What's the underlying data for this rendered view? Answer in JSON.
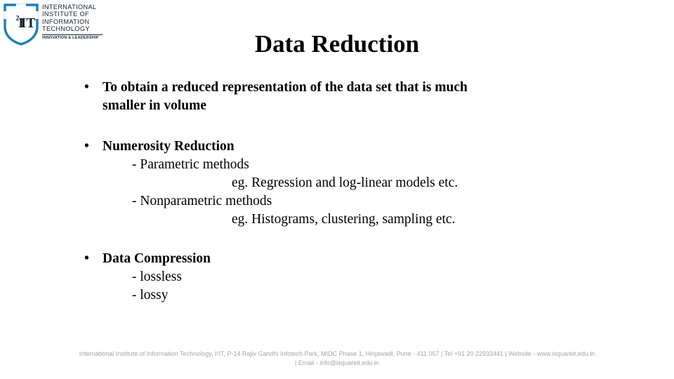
{
  "slide": {
    "title": "Data Reduction",
    "background_color": "#ffffff",
    "text_color": "#000000"
  },
  "logo": {
    "shield_icon": "i2it-shield-icon",
    "shield_color": "#1b7fb8",
    "monogram": "I2IT",
    "name_lines": [
      "INTERNATIONAL",
      "INSTITUTE OF",
      "INFORMATION",
      "TECHNOLOGY"
    ],
    "tagline": "INNOVATION & LEADERSHIP"
  },
  "content": {
    "bullet1": {
      "marker": "•",
      "line1": "To obtain a reduced representation of the data set that is much",
      "line2": "smaller in volume"
    },
    "bullet2": {
      "marker": "•",
      "heading": "Numerosity Reduction",
      "sub1": "- Parametric methods",
      "eg1": "eg. Regression and log-linear models etc.",
      "sub2": "- Nonparametric methods",
      "eg2": "eg. Histograms, clustering, sampling etc."
    },
    "bullet3": {
      "marker": "•",
      "heading": "Data Compression",
      "sub1": "- lossless",
      "sub2": "- lossy"
    }
  },
  "footer": {
    "line1": "International Institute of Information Technology, I²IT, P-14 Rajiv Gandhi Infotech Park, MIDC Phase 1, Hinjawadi, Pune - 411 057  |  Tel +91 20 22933441 | Website - www.isquareit.edu.in",
    "line2": "| Email - info@isquareit.edu.in",
    "color": "#a6a6a6"
  }
}
